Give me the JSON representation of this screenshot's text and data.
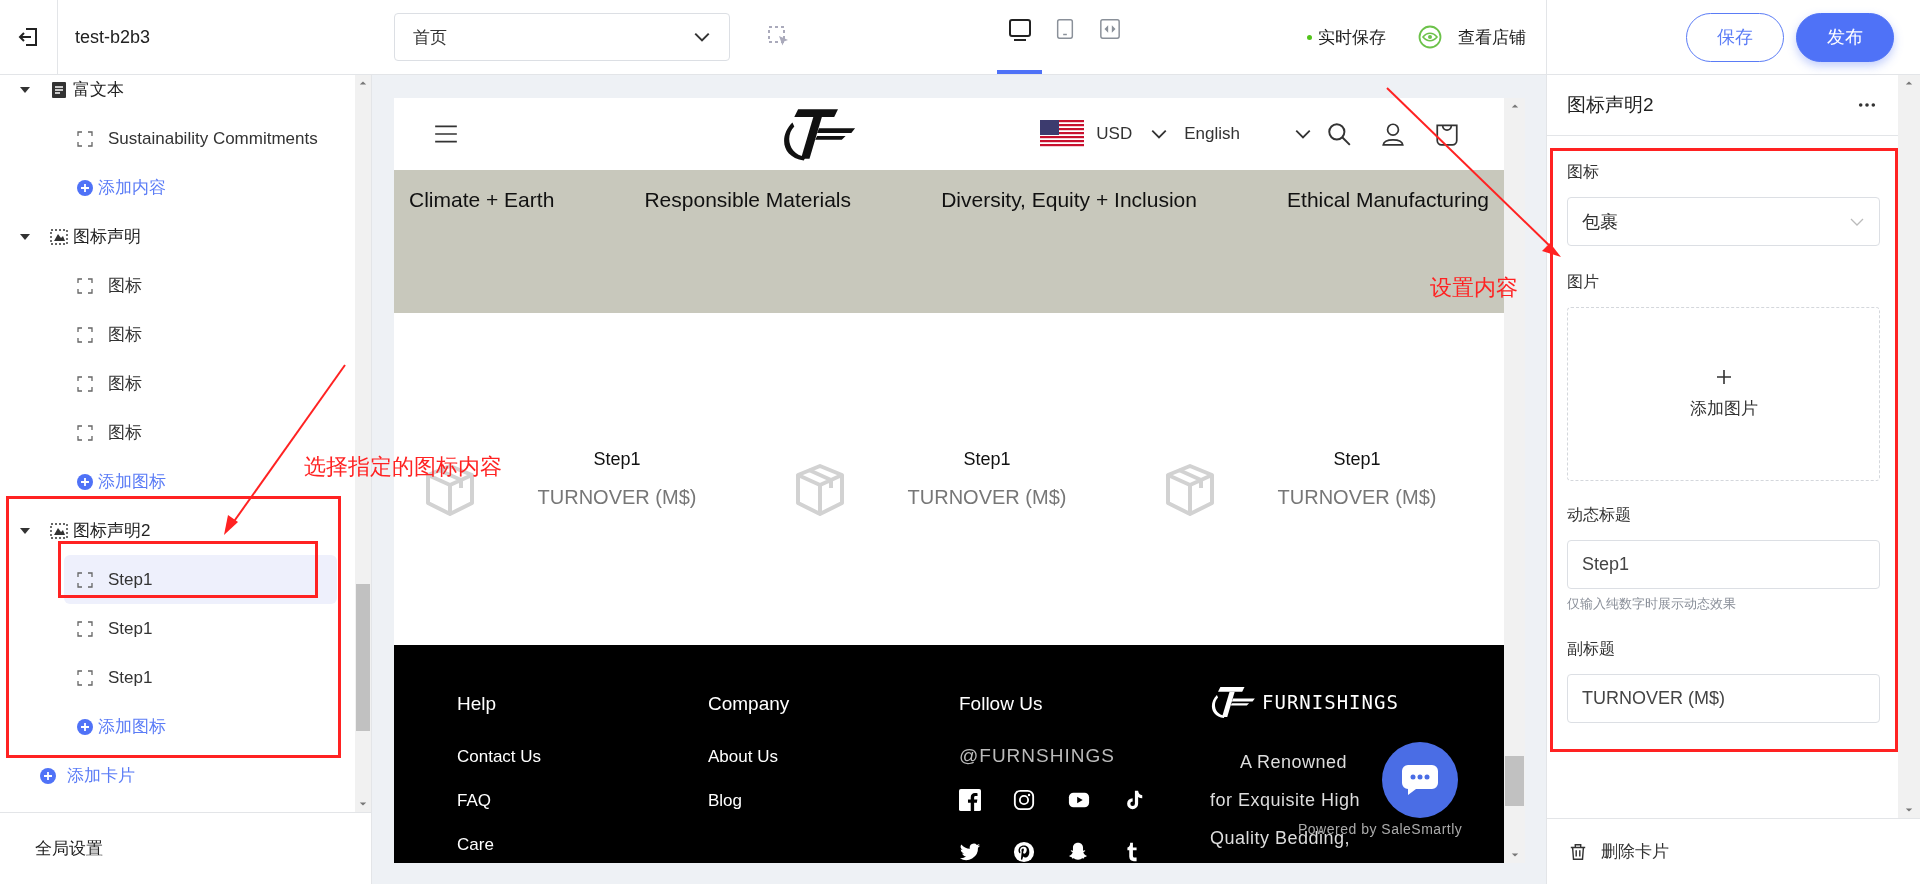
{
  "topbar": {
    "site_name": "test-b2b3",
    "page_select": {
      "value": "首页"
    },
    "devices": [
      {
        "kind": "desktop",
        "selected": true
      },
      {
        "kind": "tablet",
        "selected": false
      },
      {
        "kind": "fullwidth",
        "selected": false
      }
    ],
    "autosave": {
      "label": "实时保存",
      "on": true
    },
    "view_store": "查看店铺",
    "buttons": [
      {
        "kind": "outline",
        "label": "保存"
      },
      {
        "kind": "primary",
        "label": "发布"
      }
    ]
  },
  "sidebar": {
    "tree": [
      {
        "kind": "richtext",
        "label": "富文本",
        "expanded": true,
        "children": [
          {
            "kind": "block",
            "label": "Sustainability Commitments",
            "selected": false
          },
          {
            "kind": "add",
            "label": "添加内容"
          }
        ]
      },
      {
        "kind": "iconlist",
        "label": "图标声明",
        "expanded": true,
        "children": [
          {
            "kind": "block",
            "label": "图标",
            "selected": false
          },
          {
            "kind": "block",
            "label": "图标",
            "selected": false
          },
          {
            "kind": "block",
            "label": "图标",
            "selected": false
          },
          {
            "kind": "block",
            "label": "图标",
            "selected": false
          },
          {
            "kind": "add",
            "label": "添加图标"
          }
        ]
      },
      {
        "kind": "iconlist",
        "label": "图标声明2",
        "expanded": true,
        "children": [
          {
            "kind": "block",
            "label": "Step1",
            "selected": true
          },
          {
            "kind": "block",
            "label": "Step1",
            "selected": false
          },
          {
            "kind": "block",
            "label": "Step1",
            "selected": false
          },
          {
            "kind": "add",
            "label": "添加图标"
          }
        ]
      }
    ],
    "add_card": "添加卡片",
    "global_settings": "全局设置"
  },
  "preview": {
    "header": {
      "currency": "USD",
      "language": "English"
    },
    "nav": [
      "Climate + Earth",
      "Responsible Materials",
      "Diversity, Equity + Inclusion",
      "Ethical Manufacturing"
    ],
    "features": [
      {
        "title": "Step1",
        "subtitle": "TURNOVER (M$)"
      },
      {
        "title": "Step1",
        "subtitle": "TURNOVER (M$)"
      },
      {
        "title": "Step1",
        "subtitle": "TURNOVER (M$)"
      }
    ],
    "footer": {
      "columns": [
        {
          "heading": "Help",
          "links": [
            "Contact Us",
            "FAQ",
            "Care"
          ]
        },
        {
          "heading": "Company",
          "links": [
            "About Us",
            "Blog"
          ]
        },
        {
          "heading": "Follow Us",
          "handle": "@FURNSHINGS"
        }
      ],
      "brand": {
        "name": "FURNISHINGS",
        "lines": [
          "A Renowned",
          "for Exquisite High",
          "Quality Bedding,"
        ]
      }
    },
    "chat_widget": {
      "powered_by": "Powered by SaleSmartly"
    }
  },
  "settings_panel": {
    "title": "图标声明2",
    "fields": [
      {
        "kind": "select",
        "label": "图标",
        "value": "包裹"
      },
      {
        "kind": "upload",
        "label": "图片",
        "button": "添加图片"
      },
      {
        "kind": "input",
        "label": "动态标题",
        "value": "Step1",
        "hint": "仅输入纯数字时展示动态效果"
      },
      {
        "kind": "input",
        "label": "副标题",
        "value": "TURNOVER (M$)"
      }
    ],
    "delete": "删除卡片"
  },
  "annotations": [
    {
      "text": "选择指定的图标内容"
    },
    {
      "text": "设置内容"
    }
  ]
}
